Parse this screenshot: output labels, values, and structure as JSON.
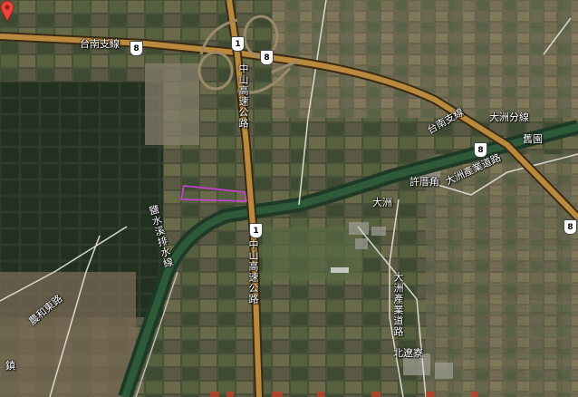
{
  "map": {
    "roads": {
      "tainan_branch": "台南支線",
      "dazhou_branch": "大洲分線",
      "zhongshan_north": "中山高速公路",
      "zhongshan_south": "中山高速公路",
      "dazhou_industrial_east": "大洲產業道路",
      "dazhou_industrial_south": "大洲產業道路",
      "yanshui_drain": "鹽水溪排水線",
      "nonghe_east": "農和東路",
      "tainan_east_lower": "台南支線"
    },
    "places": {
      "dazhou": "大洲",
      "xucuojiao": "許厝角",
      "jiuyuan": "舊園",
      "beiliaoliao": "北遼寮",
      "corner_bottom_left": "鎮"
    },
    "shields": {
      "freeway_1_top": "1",
      "freeway_1_mid": "1",
      "prov_8_top_left": "8",
      "prov_8_top_mid": "8",
      "prov_8_right": "8",
      "prov_8_edge": "8"
    },
    "marker": "selected-location"
  }
}
